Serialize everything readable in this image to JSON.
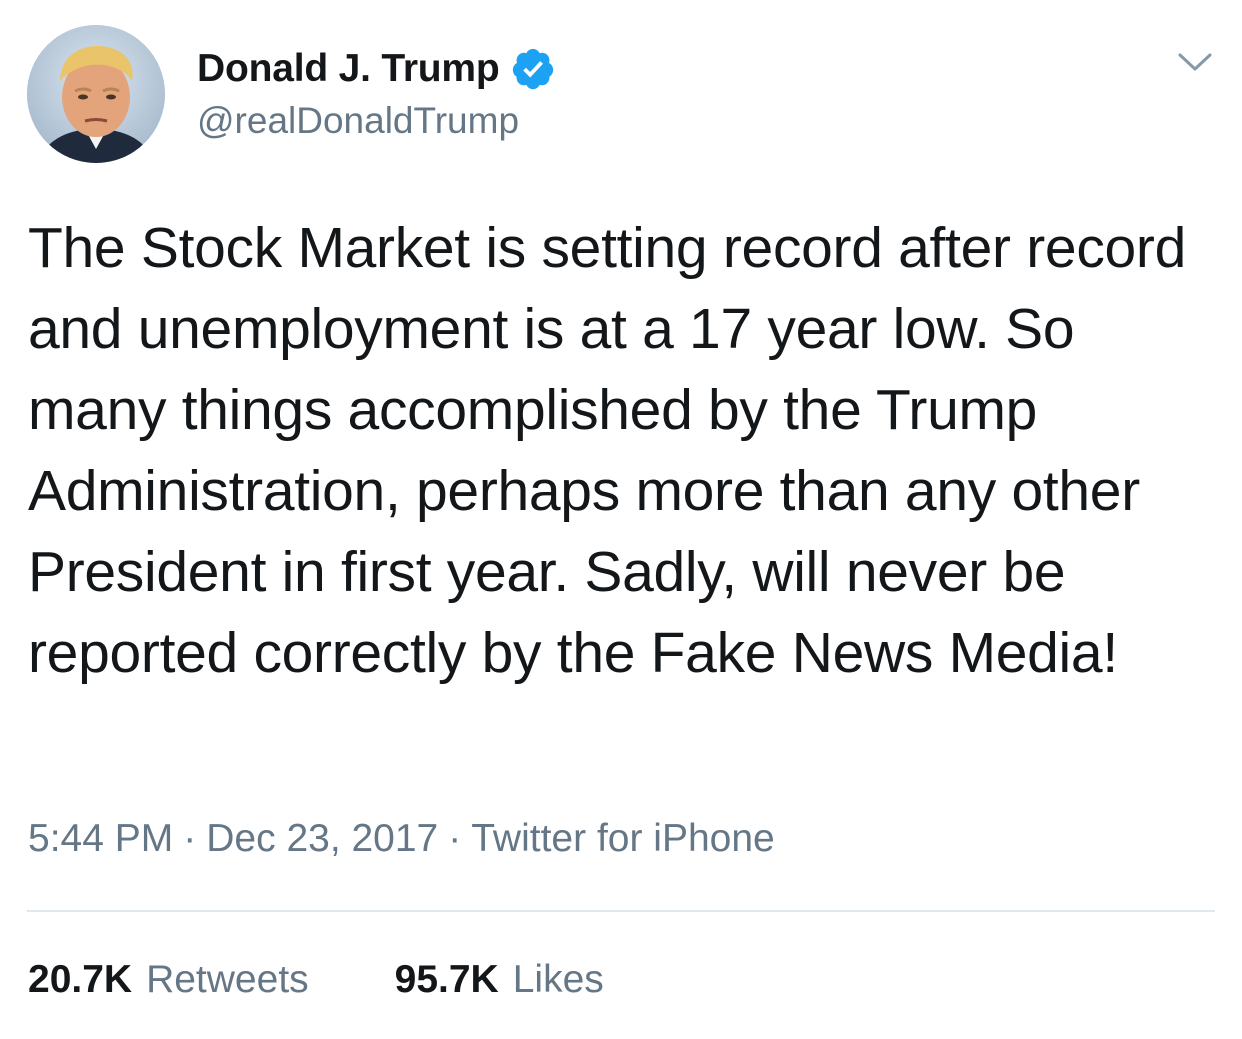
{
  "author": {
    "display_name": "Donald J. Trump",
    "handle": "@realDonaldTrump",
    "verified": true
  },
  "tweet": {
    "text": "The Stock Market is setting record after record and unemployment is at a 17 year low. So many things accomplished by the Trump Administration, perhaps more than any other President in first year. Sadly, will never be reported correctly by the Fake News Media!"
  },
  "meta": {
    "time": "5:44 PM",
    "separator": "·",
    "date": "Dec 23, 2017",
    "source": "Twitter for iPhone"
  },
  "stats": {
    "retweets_count": "20.7K",
    "retweets_label": "Retweets",
    "likes_count": "95.7K",
    "likes_label": "Likes"
  },
  "colors": {
    "text_primary": "#14171a",
    "text_secondary": "#657786",
    "verified_badge": "#1da1f2",
    "divider": "#e1e8ed"
  },
  "icons": {
    "verified": "verified-badge-icon",
    "menu": "chevron-down-icon"
  }
}
